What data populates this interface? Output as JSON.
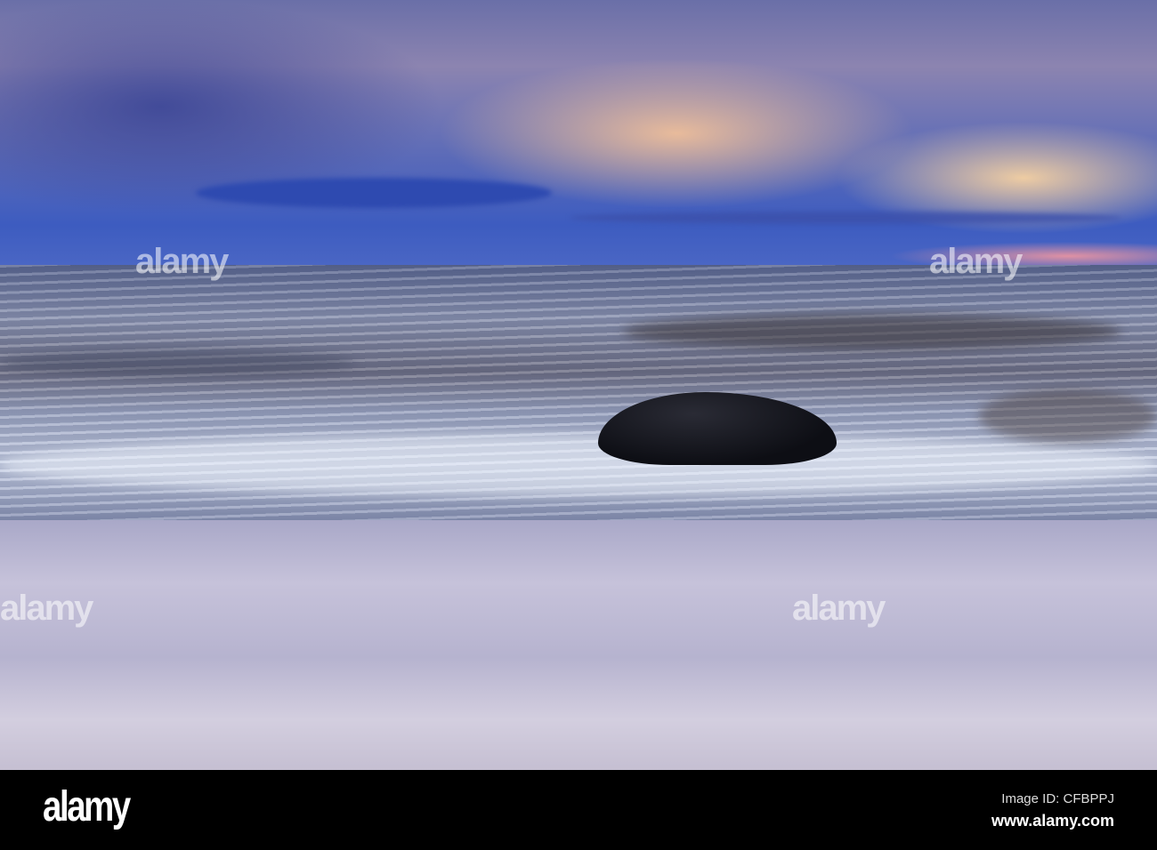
{
  "watermark": {
    "brand": "alamy"
  },
  "footer": {
    "logo": "alamy",
    "image_id": "Image ID: CFBPPJ",
    "url": "www.alamy.com"
  }
}
